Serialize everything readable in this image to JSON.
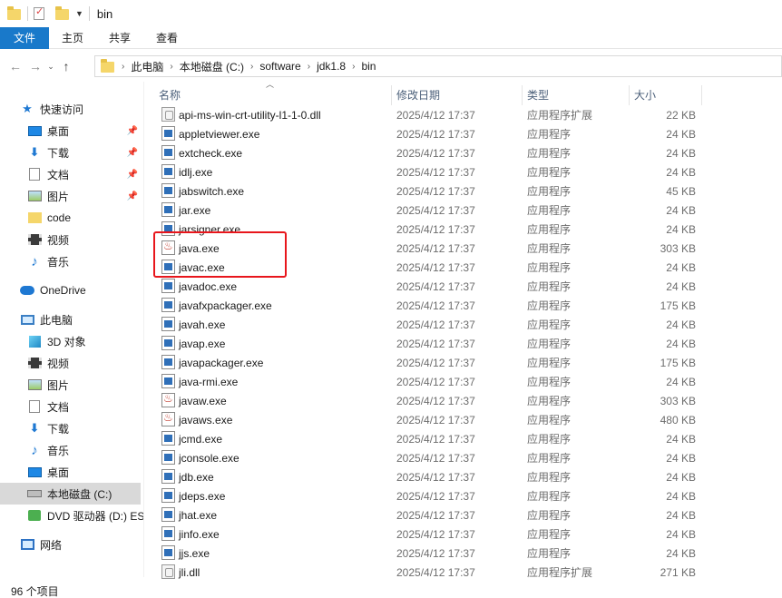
{
  "window": {
    "title": "bin"
  },
  "ribbon": {
    "tabs": [
      "文件",
      "主页",
      "共享",
      "查看"
    ]
  },
  "address": {
    "crumbs": [
      "此电脑",
      "本地磁盘 (C:)",
      "software",
      "jdk1.8",
      "bin"
    ]
  },
  "sidebar": {
    "quick_access": "快速访问",
    "qa_items": [
      {
        "label": "桌面",
        "icon": "desktop-icon",
        "pinned": true
      },
      {
        "label": "下载",
        "icon": "download-icon",
        "pinned": true
      },
      {
        "label": "文档",
        "icon": "document-icon",
        "pinned": true
      },
      {
        "label": "图片",
        "icon": "picture-icon",
        "pinned": true
      },
      {
        "label": "code",
        "icon": "folder-icon",
        "pinned": false
      },
      {
        "label": "视频",
        "icon": "video-icon",
        "pinned": false
      },
      {
        "label": "音乐",
        "icon": "music-icon",
        "pinned": false
      }
    ],
    "onedrive": "OneDrive",
    "this_pc": "此电脑",
    "pc_items": [
      {
        "label": "3D 对象",
        "icon": "3d-objects-icon"
      },
      {
        "label": "视频",
        "icon": "video-icon"
      },
      {
        "label": "图片",
        "icon": "picture-icon"
      },
      {
        "label": "文档",
        "icon": "document-icon"
      },
      {
        "label": "下载",
        "icon": "download-icon"
      },
      {
        "label": "音乐",
        "icon": "music-icon"
      },
      {
        "label": "桌面",
        "icon": "desktop-icon"
      },
      {
        "label": "本地磁盘 (C:)",
        "icon": "drive-icon"
      },
      {
        "label": "DVD 驱动器 (D:) ES",
        "icon": "dvd-icon"
      }
    ],
    "network": "网络"
  },
  "columns": {
    "name": "名称",
    "date": "修改日期",
    "type": "类型",
    "size": "大小"
  },
  "files": [
    {
      "name": "api-ms-win-crt-utility-l1-1-0.dll",
      "date": "2025/4/12 17:37",
      "type": "应用程序扩展",
      "size": "22 KB",
      "icon": "dll"
    },
    {
      "name": "appletviewer.exe",
      "date": "2025/4/12 17:37",
      "type": "应用程序",
      "size": "24 KB",
      "icon": "exe"
    },
    {
      "name": "extcheck.exe",
      "date": "2025/4/12 17:37",
      "type": "应用程序",
      "size": "24 KB",
      "icon": "exe"
    },
    {
      "name": "idlj.exe",
      "date": "2025/4/12 17:37",
      "type": "应用程序",
      "size": "24 KB",
      "icon": "exe"
    },
    {
      "name": "jabswitch.exe",
      "date": "2025/4/12 17:37",
      "type": "应用程序",
      "size": "45 KB",
      "icon": "exe"
    },
    {
      "name": "jar.exe",
      "date": "2025/4/12 17:37",
      "type": "应用程序",
      "size": "24 KB",
      "icon": "exe"
    },
    {
      "name": "jarsigner.exe",
      "date": "2025/4/12 17:37",
      "type": "应用程序",
      "size": "24 KB",
      "icon": "exe"
    },
    {
      "name": "java.exe",
      "date": "2025/4/12 17:37",
      "type": "应用程序",
      "size": "303 KB",
      "icon": "java"
    },
    {
      "name": "javac.exe",
      "date": "2025/4/12 17:37",
      "type": "应用程序",
      "size": "24 KB",
      "icon": "exe"
    },
    {
      "name": "javadoc.exe",
      "date": "2025/4/12 17:37",
      "type": "应用程序",
      "size": "24 KB",
      "icon": "exe"
    },
    {
      "name": "javafxpackager.exe",
      "date": "2025/4/12 17:37",
      "type": "应用程序",
      "size": "175 KB",
      "icon": "exe"
    },
    {
      "name": "javah.exe",
      "date": "2025/4/12 17:37",
      "type": "应用程序",
      "size": "24 KB",
      "icon": "exe"
    },
    {
      "name": "javap.exe",
      "date": "2025/4/12 17:37",
      "type": "应用程序",
      "size": "24 KB",
      "icon": "exe"
    },
    {
      "name": "javapackager.exe",
      "date": "2025/4/12 17:37",
      "type": "应用程序",
      "size": "175 KB",
      "icon": "exe"
    },
    {
      "name": "java-rmi.exe",
      "date": "2025/4/12 17:37",
      "type": "应用程序",
      "size": "24 KB",
      "icon": "exe"
    },
    {
      "name": "javaw.exe",
      "date": "2025/4/12 17:37",
      "type": "应用程序",
      "size": "303 KB",
      "icon": "java"
    },
    {
      "name": "javaws.exe",
      "date": "2025/4/12 17:37",
      "type": "应用程序",
      "size": "480 KB",
      "icon": "java"
    },
    {
      "name": "jcmd.exe",
      "date": "2025/4/12 17:37",
      "type": "应用程序",
      "size": "24 KB",
      "icon": "exe"
    },
    {
      "name": "jconsole.exe",
      "date": "2025/4/12 17:37",
      "type": "应用程序",
      "size": "24 KB",
      "icon": "exe"
    },
    {
      "name": "jdb.exe",
      "date": "2025/4/12 17:37",
      "type": "应用程序",
      "size": "24 KB",
      "icon": "exe"
    },
    {
      "name": "jdeps.exe",
      "date": "2025/4/12 17:37",
      "type": "应用程序",
      "size": "24 KB",
      "icon": "exe"
    },
    {
      "name": "jhat.exe",
      "date": "2025/4/12 17:37",
      "type": "应用程序",
      "size": "24 KB",
      "icon": "exe"
    },
    {
      "name": "jinfo.exe",
      "date": "2025/4/12 17:37",
      "type": "应用程序",
      "size": "24 KB",
      "icon": "exe"
    },
    {
      "name": "jjs.exe",
      "date": "2025/4/12 17:37",
      "type": "应用程序",
      "size": "24 KB",
      "icon": "exe"
    },
    {
      "name": "jli.dll",
      "date": "2025/4/12 17:37",
      "type": "应用程序扩展",
      "size": "271 KB",
      "icon": "dll"
    }
  ],
  "status": {
    "item_count": "96 个项目"
  },
  "colors": {
    "accent": "#1979ca",
    "highlight_box": "#e8161c",
    "selected_drive_bg": "#d9d9d9"
  }
}
